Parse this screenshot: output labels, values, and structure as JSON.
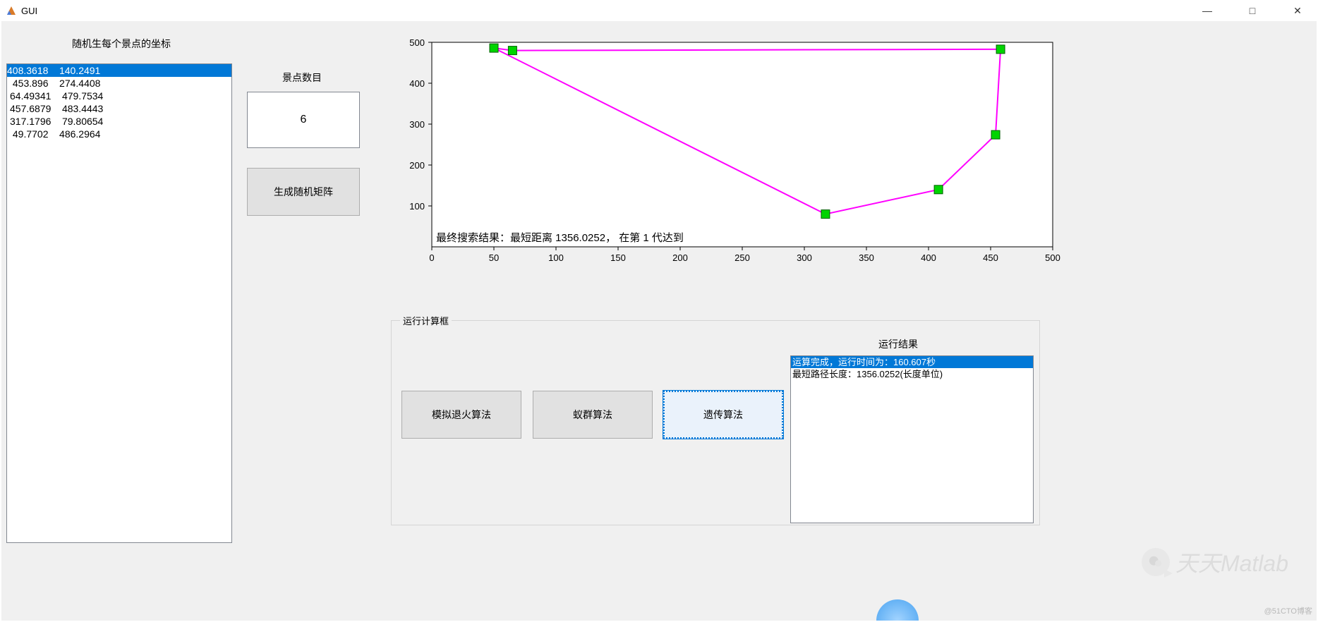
{
  "window": {
    "title": "GUI",
    "minimize": "—",
    "maximize": "□",
    "close": "✕"
  },
  "left": {
    "coords_label": "随机生每个景点的坐标",
    "coords": [
      "408.3618    140.2491",
      " 453.896    274.4408",
      "64.49341    479.7534",
      "457.6879    483.4443",
      "317.1796    79.80654",
      " 49.7702    486.2964"
    ]
  },
  "count": {
    "label": "景点数目",
    "value": "6"
  },
  "buttons": {
    "generate": "生成随机矩阵",
    "sa": "模拟退火算法",
    "aco": "蚁群算法",
    "ga": "遗传算法"
  },
  "compute": {
    "legend": "运行计算框",
    "result_label": "运行结果",
    "results": [
      "运算完成，运行时间为：160.607秒",
      "最短路径长度：1356.0252(长度单位)"
    ]
  },
  "watermark": "天天Matlab",
  "credit": "@51CTO博客",
  "chart_data": {
    "type": "line",
    "title": "",
    "xlabel": "",
    "ylabel": "",
    "xlim": [
      0,
      500
    ],
    "ylim": [
      0,
      500
    ],
    "xticks": [
      0,
      50,
      100,
      150,
      200,
      250,
      300,
      350,
      400,
      450,
      500
    ],
    "yticks": [
      100,
      200,
      300,
      400,
      500
    ],
    "annotation": "最终搜索结果：最短距离 1356.0252， 在第 1 代达到",
    "series": [
      {
        "name": "path",
        "color": "#ff00ff",
        "x": [
          50,
          65,
          458,
          454,
          408,
          317,
          50
        ],
        "y": [
          486,
          480,
          483,
          274,
          140,
          80,
          486
        ]
      }
    ],
    "points": [
      {
        "x": 50,
        "y": 486
      },
      {
        "x": 65,
        "y": 480
      },
      {
        "x": 458,
        "y": 483
      },
      {
        "x": 454,
        "y": 274
      },
      {
        "x": 408,
        "y": 140
      },
      {
        "x": 317,
        "y": 80
      }
    ]
  }
}
